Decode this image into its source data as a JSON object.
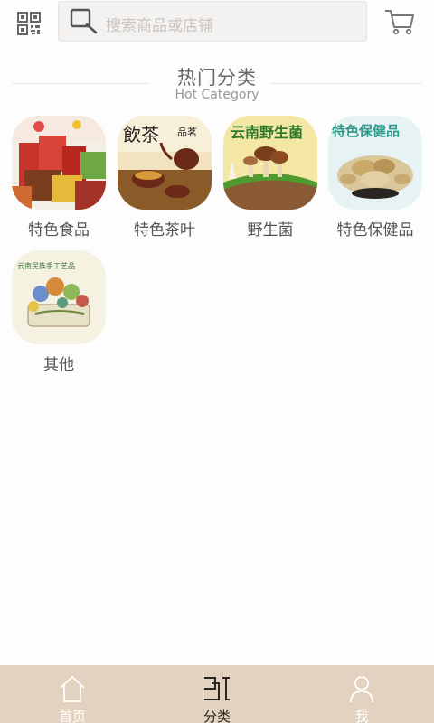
{
  "header": {
    "qr_icon": "qr-code-icon",
    "search_placeholder": "搜索商品或店铺",
    "search_icon": "search-icon",
    "cart_icon": "cart-icon"
  },
  "section": {
    "title_zh": "热门分类",
    "title_en": "Hot Category"
  },
  "categories": [
    {
      "label": "特色食品",
      "image": "特色食品"
    },
    {
      "label": "特色茶叶",
      "image": "特色茶叶"
    },
    {
      "label": "野生菌",
      "image": "野生菌"
    },
    {
      "label": "特色保健品",
      "image": "特色保健品"
    },
    {
      "label": "其他",
      "image": "其他"
    }
  ],
  "tabbar": {
    "tabs": [
      {
        "label": "首页",
        "icon": "home-icon",
        "active": false
      },
      {
        "label": "分类",
        "icon": "category-icon",
        "active": true
      },
      {
        "label": "我",
        "icon": "user-icon",
        "active": false
      }
    ]
  },
  "colors": {
    "tabbar_bg": "#e3d2bf",
    "search_bg": "#f4f2f0"
  }
}
